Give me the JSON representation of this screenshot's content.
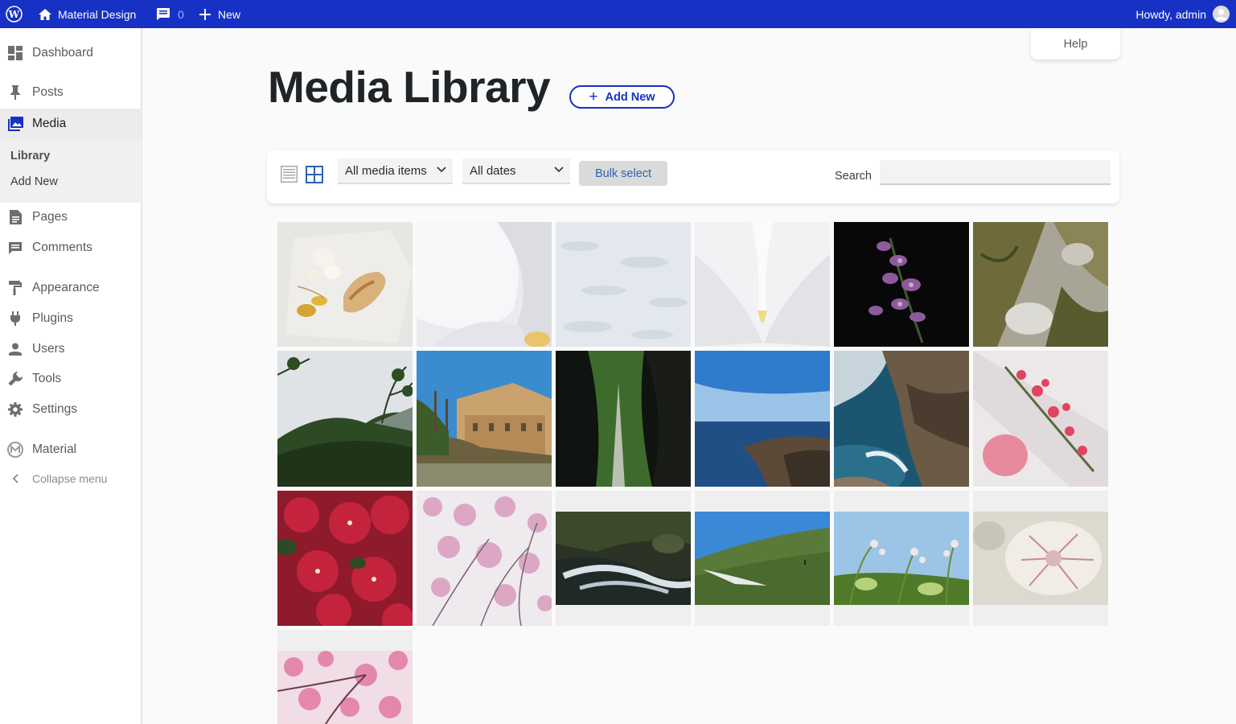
{
  "adminbar": {
    "site_name": "Material Design",
    "comments_count": "0",
    "new_label": "New",
    "greeting": "Howdy, admin"
  },
  "sidebar": {
    "items": [
      {
        "label": "Dashboard",
        "icon": "dashboard-icon"
      },
      {
        "label": "Posts",
        "icon": "pin-icon"
      },
      {
        "label": "Media",
        "icon": "media-icon",
        "active": true
      },
      {
        "label": "Pages",
        "icon": "page-icon"
      },
      {
        "label": "Comments",
        "icon": "comment-icon"
      },
      {
        "label": "Appearance",
        "icon": "brush-icon"
      },
      {
        "label": "Plugins",
        "icon": "plug-icon"
      },
      {
        "label": "Users",
        "icon": "user-icon"
      },
      {
        "label": "Tools",
        "icon": "wrench-icon"
      },
      {
        "label": "Settings",
        "icon": "gear-icon"
      },
      {
        "label": "Material",
        "icon": "material-logo-icon"
      }
    ],
    "submenu": [
      "Library",
      "Add New"
    ],
    "collapse_label": "Collapse menu"
  },
  "help_label": "Help",
  "page_title": "Media Library",
  "add_new_label": "Add New",
  "toolbar": {
    "type_filter": "All media items",
    "date_filter": "All dates",
    "bulk_select_label": "Bulk select",
    "search_label": "Search",
    "search_value": ""
  },
  "colors": {
    "accent": "#1631c4",
    "admin_bar": "#1631c4"
  },
  "media_items": [
    "white-flowers-and-dry-leaf",
    "white-orchid-petal-closeup",
    "snow-surface",
    "white-orchid-center",
    "purple-flowers-dark",
    "mossy-rock",
    "hill-with-trees",
    "palace-by-water",
    "forest-through-rocks",
    "coastal-cliffs-blue-sea",
    "sea-cliffs-waves",
    "pink-blossom-branch",
    "red-bougainvillea",
    "pink-wildflowers",
    "waterfall-stream",
    "green-hill-blue-sky",
    "wildflowers-sky",
    "pink-flower-macro",
    "pink-cherry-blossom"
  ]
}
